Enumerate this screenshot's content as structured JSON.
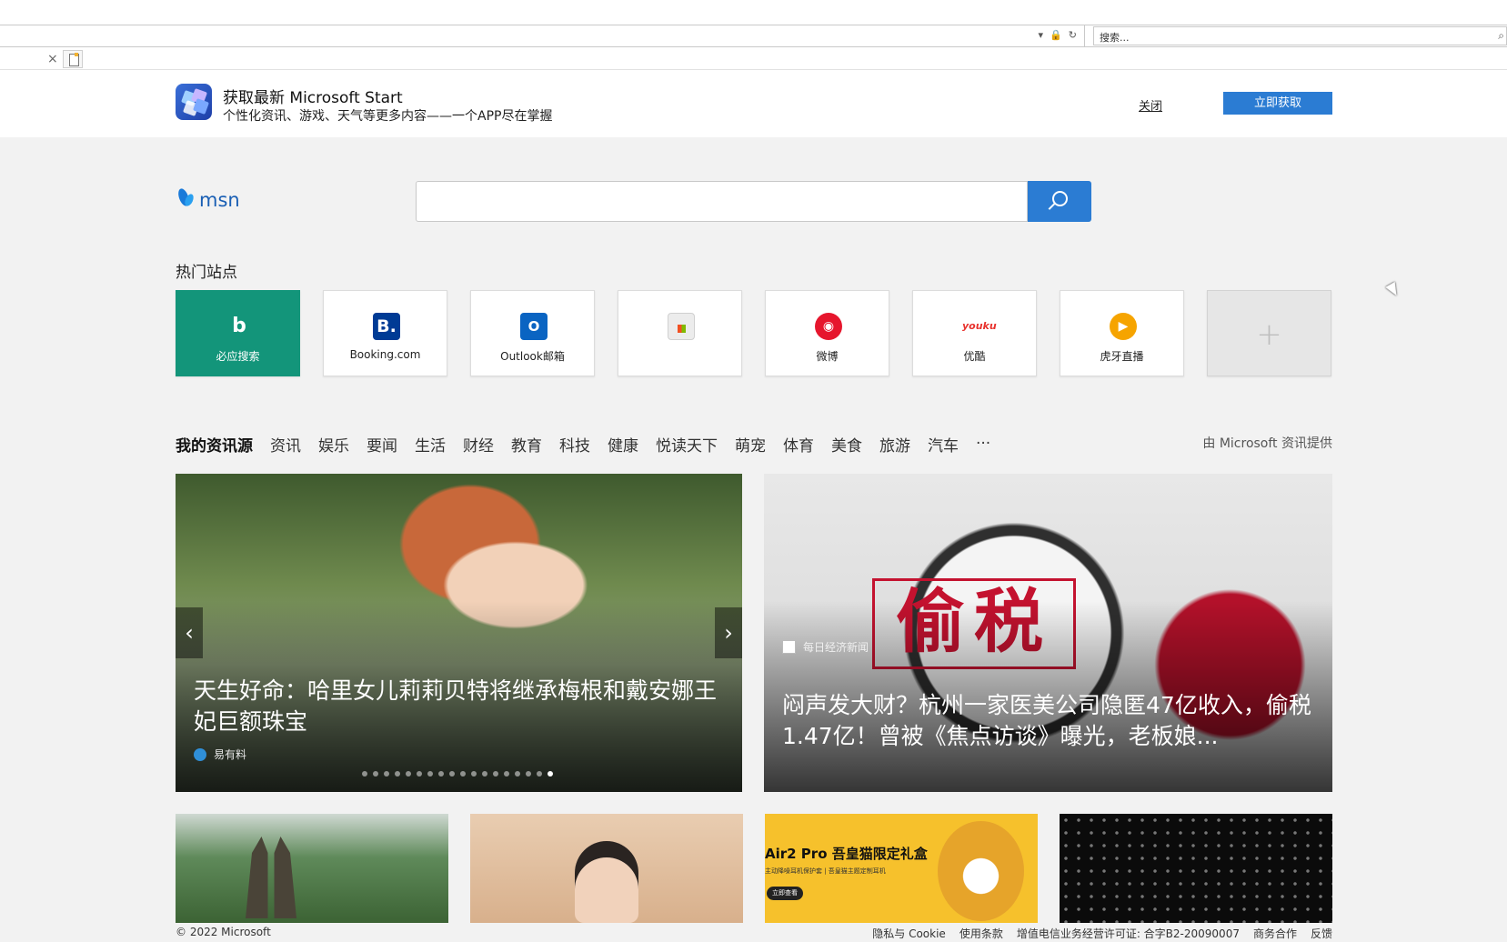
{
  "browser": {
    "search_placeholder": "搜索...",
    "close_tab_glyph": "×"
  },
  "promo": {
    "title": "获取最新 Microsoft Start",
    "subtitle": "个性化资讯、游戏、天气等更多内容——一个APP尽在掌握",
    "close_label": "关闭",
    "get_label": "立即获取"
  },
  "header": {
    "logo_text": "msn",
    "search_value": ""
  },
  "top_sites": {
    "title": "热门站点",
    "items": [
      {
        "label": "必应搜索",
        "icon": "bing-icon",
        "glyph": "b"
      },
      {
        "label": "Booking.com",
        "icon": "booking-icon",
        "glyph": "B."
      },
      {
        "label": "Outlook邮箱",
        "icon": "outlook-icon",
        "glyph": "O"
      },
      {
        "label": "",
        "icon": "microsoft-store-icon",
        "glyph": ""
      },
      {
        "label": "微博",
        "icon": "weibo-icon",
        "glyph": "◉"
      },
      {
        "label": "优酷",
        "icon": "youku-icon",
        "glyph": "youku"
      },
      {
        "label": "虎牙直播",
        "icon": "huya-icon",
        "glyph": "▶"
      }
    ],
    "add_glyph": "+"
  },
  "nav": {
    "tabs": [
      "我的资讯源",
      "资讯",
      "娱乐",
      "要闻",
      "生活",
      "财经",
      "教育",
      "科技",
      "健康",
      "悦读天下",
      "萌宠",
      "体育",
      "美食",
      "旅游",
      "汽车",
      "···"
    ],
    "active": "我的资讯源",
    "provider": "由 Microsoft 资讯提供"
  },
  "hero": {
    "left": {
      "title": "天生好命：哈里女儿莉莉贝特将继承梅根和戴安娜王妃巨额珠宝",
      "source": "易有料",
      "prev_glyph": "‹",
      "next_glyph": "›",
      "slide_count": 18,
      "active_slide": 18
    },
    "right": {
      "stamp_text": "偷税",
      "source": "每日经济新闻",
      "title": "闷声发大财？杭州一家医美公司隐匿47亿收入，偷税1.47亿！曾被《焦点访谈》曝光，老板娘..."
    }
  },
  "cards": {
    "card3": {
      "headline": "Air2 Pro 吾皇猫限定礼盒",
      "subline": "主动降噪耳机保护套 | 吾皇猫主题定制耳机",
      "button": "立即查看"
    }
  },
  "footer": {
    "copyright": "© 2022 Microsoft",
    "links": [
      "隐私与 Cookie",
      "使用条款",
      "增值电信业务经营许可证: 合字B2-20090007",
      "商务合作",
      "反馈"
    ]
  },
  "colors": {
    "accent": "#2b7cd3",
    "bing_tile": "#13957a",
    "background": "#f2f2f2"
  }
}
